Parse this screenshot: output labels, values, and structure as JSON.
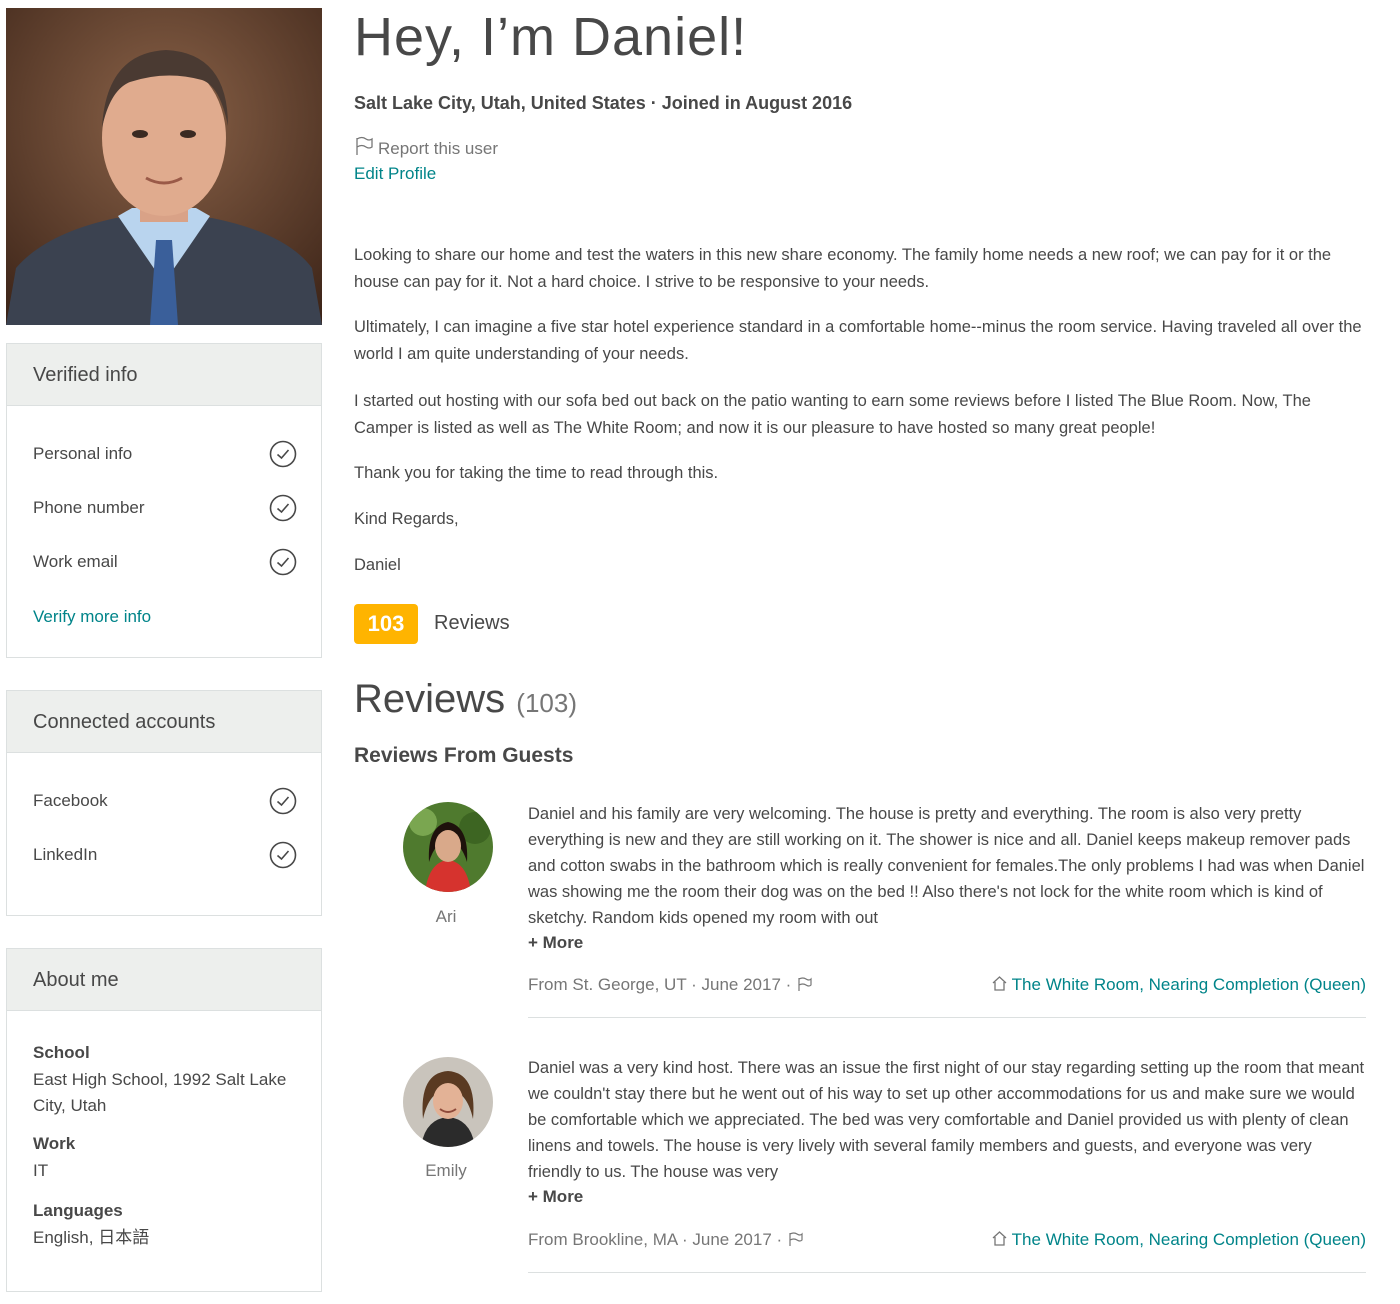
{
  "profile": {
    "heading": "Hey, I’m Daniel!",
    "location_joined": "Salt Lake City, Utah, United States · Joined in August 2016",
    "report_label": "Report this user",
    "edit_label": "Edit Profile",
    "bio": [
      "Looking to share our home and test the waters in this new share economy. The family home needs a new roof; we can pay for it or the house can pay for it. Not a hard choice. I strive to be responsive to your needs.",
      "Ultimately, I can imagine a five star hotel experience standard in a comfortable home--minus the room service. Having traveled all over the world I am quite understanding of your needs.",
      "I started out hosting with our sofa bed out back on the patio wanting to earn some reviews before I listed The Blue Room. Now, The Camper is listed as well as The White Room; and now it is our pleasure to have hosted so many great people!",
      "Thank you for taking the time to read through this.",
      "Kind Regards,",
      "Daniel"
    ],
    "review_badge": "103",
    "review_badge_label": "Reviews"
  },
  "verified": {
    "title": "Verified info",
    "items": [
      {
        "label": "Personal info",
        "icon": "check-circle-icon"
      },
      {
        "label": "Phone number",
        "icon": "check-circle-icon"
      },
      {
        "label": "Work email",
        "icon": "check-circle-icon"
      }
    ],
    "more_link": "Verify more info"
  },
  "connected": {
    "title": "Connected accounts",
    "items": [
      {
        "label": "Facebook",
        "icon": "check-circle-icon"
      },
      {
        "label": "LinkedIn",
        "icon": "check-circle-icon"
      }
    ]
  },
  "about": {
    "title": "About me",
    "school_label": "School",
    "school_value": "East High School, 1992 Salt Lake City, Utah",
    "work_label": "Work",
    "work_value": "IT",
    "languages_label": "Languages",
    "languages_value": "English, 日本語"
  },
  "reviews": {
    "title": "Reviews",
    "count": "(103)",
    "subtitle": "Reviews From Guests",
    "items": [
      {
        "name": "Ari",
        "text": "Daniel and his family are very welcoming. The house is pretty and everything. The room is also very pretty everything is new and they are still working on it. The shower is nice and all. Daniel keeps makeup remover pads and cotton swabs in the bathroom which is really convenient for females.The only problems I had was when Daniel was showing me the room their dog was on the bed !! Also there's not lock for the white room which is kind of sketchy. Random kids opened my room with out",
        "more": "+ More",
        "meta": "From St. George, UT · June 2017 ·",
        "listing": "The White Room, Nearing Completion (Queen)"
      },
      {
        "name": "Emily",
        "text": "Daniel was a very kind host. There was an issue the first night of our stay regarding setting up the room that meant we couldn't stay there but he went out of his way to set up other accommodations for us and make sure we would be comfortable which we appreciated. The bed was very comfortable and Daniel provided us with plenty of clean linens and towels. The house is very lively with several family members and guests, and everyone was very friendly to us. The house was very",
        "more": "+ More",
        "meta": "From Brookline, MA · June 2017 ·",
        "listing": "The White Room, Nearing Completion (Queen)"
      }
    ]
  },
  "colors": {
    "accent": "#008489",
    "badge": "#ffb400",
    "panel_header": "#edefed",
    "text": "#484848"
  }
}
